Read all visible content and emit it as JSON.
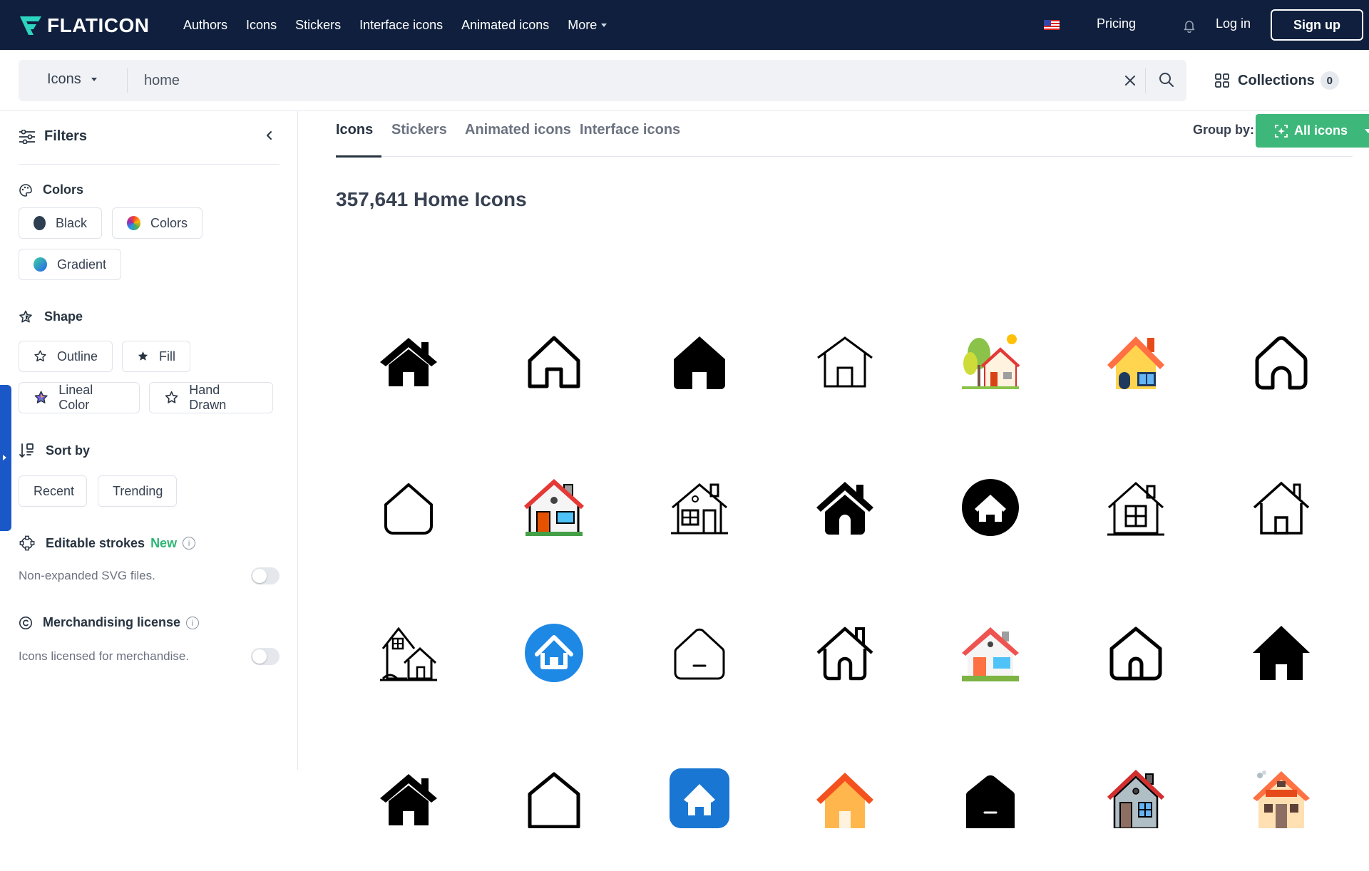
{
  "header": {
    "logo": "FLATICON",
    "nav": [
      "Authors",
      "Icons",
      "Stickers",
      "Interface icons",
      "Animated icons",
      "More"
    ],
    "pricing": "Pricing",
    "login": "Log in",
    "signup": "Sign up"
  },
  "search": {
    "type": "Icons",
    "query": "home",
    "collections_label": "Collections",
    "collections_count": "0"
  },
  "sidebar": {
    "title": "Filters",
    "colors": {
      "title": "Colors",
      "options": [
        "Black",
        "Colors",
        "Gradient"
      ]
    },
    "shape": {
      "title": "Shape",
      "options": [
        "Outline",
        "Fill",
        "Lineal Color",
        "Hand Drawn"
      ]
    },
    "sort": {
      "title": "Sort by",
      "options": [
        "Recent",
        "Trending"
      ]
    },
    "editable": {
      "title": "Editable strokes",
      "new_label": "New",
      "description": "Non-expanded SVG files."
    },
    "merch": {
      "title": "Merchandising license",
      "description": "Icons licensed for merchandise."
    }
  },
  "main": {
    "tabs": [
      "Icons",
      "Stickers",
      "Animated icons",
      "Interface icons"
    ],
    "group_by_label": "Group by:",
    "group_by_value": "All icons",
    "results_title": "357,641 Home Icons"
  },
  "icons": [
    "home-solid-icon",
    "home-outline-icon",
    "home-rounded-solid-icon",
    "home-thin-outline-icon",
    "home-trees-color-icon",
    "home-yellow-color-icon",
    "home-rounded-outline-icon",
    "home-simple-outline-icon",
    "home-color-window-icon",
    "home-lineal-chimney-icon",
    "home-chimney-solid-icon",
    "home-circle-black-icon",
    "home-window-outline-icon",
    "home-chimney-outline-icon",
    "houses-outline-icon",
    "home-circle-blue-icon",
    "home-rounded-minus-icon",
    "home-chimney-outline-2-icon",
    "home-red-roof-color-icon",
    "home-outline-3-icon",
    "home-solid-3-icon",
    "home-solid-4-icon",
    "home-pentagon-outline-icon",
    "home-blue-square-icon",
    "home-orange-color-icon",
    "home-black-rounded-icon",
    "home-color-detailed-icon",
    "home-hand-drawn-color-icon"
  ],
  "colors": {
    "nav_bg": "#0f1f3d",
    "accent_green": "#3db77a",
    "handle_blue": "#1a58c7"
  }
}
